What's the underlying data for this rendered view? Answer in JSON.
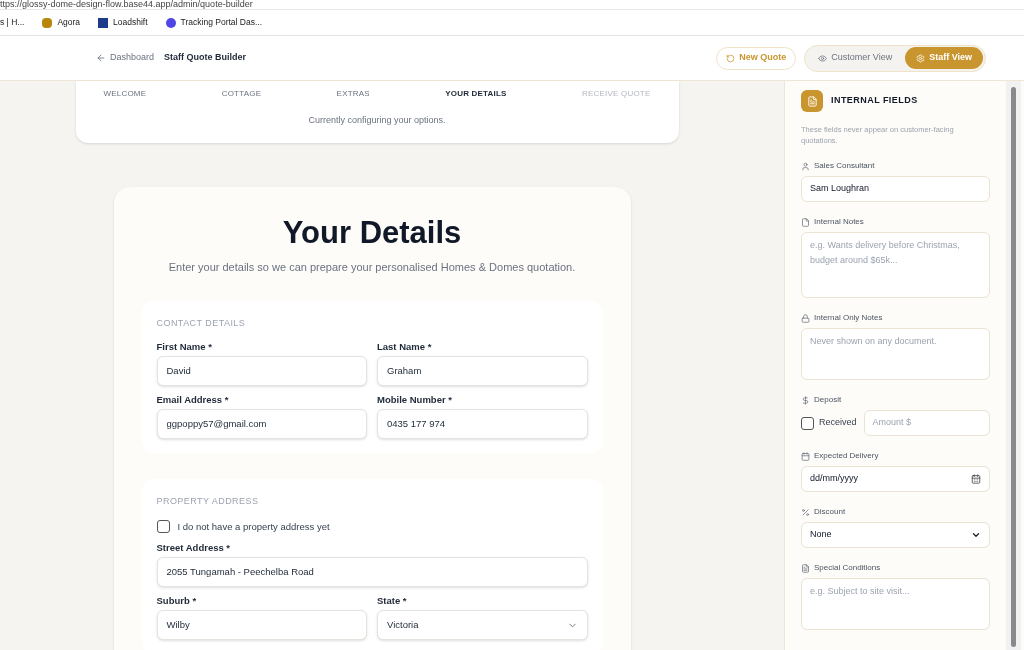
{
  "browser": {
    "url": "ttps://glossy-dome-design-flow.base44.app/admin/quote-builder",
    "bookmarks": [
      {
        "label": "s | H..."
      },
      {
        "label": "Agora"
      },
      {
        "label": "Loadshift"
      },
      {
        "label": "Tracking Portal Das..."
      }
    ]
  },
  "header": {
    "back_link": "Dashboard",
    "title": "Staff Quote Builder",
    "new_quote_button": "New Quote",
    "views": [
      {
        "label": "Customer View",
        "selected": false
      },
      {
        "label": "Staff View",
        "selected": true
      }
    ]
  },
  "steps": {
    "items": [
      {
        "label": "WELCOME",
        "kind": "done"
      },
      {
        "label": "COTTAGE",
        "kind": "done"
      },
      {
        "label": "EXTRAS",
        "kind": "done"
      },
      {
        "label": "YOUR DETAILS",
        "kind": "current"
      },
      {
        "label": "RECEIVE QUOTE",
        "kind": "upcoming"
      }
    ],
    "caption": "Currently configuring your options."
  },
  "form": {
    "title": "Your Details",
    "subtitle": "Enter your details so we can prepare your personalised Homes & Domes quotation.",
    "sections": [
      {
        "heading": "CONTACT DETAILS",
        "fields": [
          {
            "kind": "text",
            "label": "First Name *",
            "value": "David"
          },
          {
            "kind": "text",
            "label": "Last Name *",
            "value": "Graham"
          },
          {
            "kind": "text",
            "label": "Email Address *",
            "value": "ggpoppy57@gmail.com"
          },
          {
            "kind": "text",
            "label": "Mobile Number *",
            "value": "0435 177 974"
          }
        ]
      },
      {
        "heading": "PROPERTY ADDRESS",
        "fields": [
          {
            "kind": "checkbox",
            "label": "I do not have a property address yet",
            "checked": false
          },
          {
            "kind": "wide_text",
            "label": "Street Address *",
            "value": "2055 Tungamah - Peechelba Road"
          },
          {
            "kind": "text",
            "label": "Suburb *",
            "value": "Wilby"
          },
          {
            "kind": "select",
            "label": "State *",
            "value": "Victoria"
          }
        ]
      }
    ]
  },
  "internal": {
    "title": "INTERNAL FIELDS",
    "note": "These fields never appear on customer-facing quotations.",
    "fields": [
      {
        "kind": "input",
        "label": "Sales Consultant",
        "value": "Sam Loughran"
      },
      {
        "kind": "textarea",
        "label": "Internal Notes",
        "placeholder": "e.g. Wants delivery before Christmas, budget around $65k..."
      },
      {
        "kind": "textarea",
        "label": "Internal Only Notes",
        "placeholder": "Never shown on any document."
      },
      {
        "kind": "deposit",
        "label": "Deposit",
        "checkbox_label": "Received",
        "checked": false,
        "placeholder": "Amount $"
      },
      {
        "kind": "date",
        "label": "Expected Delivery",
        "placeholder": "dd/mm/yyyy"
      },
      {
        "kind": "select",
        "label": "Discount",
        "value": "None"
      },
      {
        "kind": "textarea",
        "label": "Special Conditions",
        "placeholder": "e.g. Subject to site visit..."
      }
    ]
  }
}
